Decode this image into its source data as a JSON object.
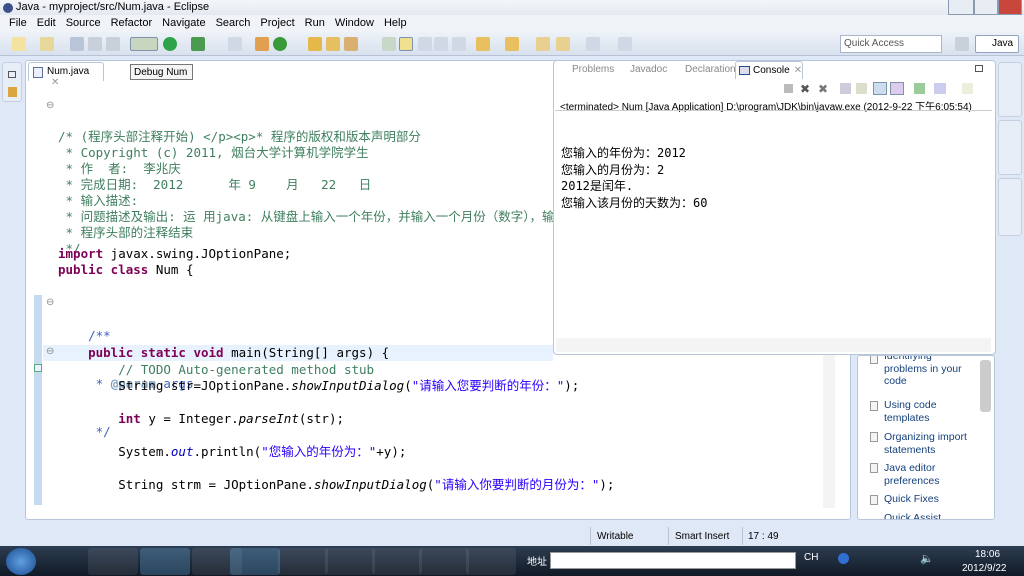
{
  "window": {
    "title": "Java - myproject/src/Num.java - Eclipse"
  },
  "menu": [
    "File",
    "Edit",
    "Source",
    "Refactor",
    "Navigate",
    "Search",
    "Project",
    "Run",
    "Window",
    "Help"
  ],
  "toolbar": {
    "quick_access_placeholder": "Quick Access",
    "perspective": "Java"
  },
  "editor": {
    "tab": "Num.java",
    "tooltip": "Debug Num",
    "comment": [
      "/* (程序头部注释开始) </p><p>* 程序的版权和版本声明部分",
      " * Copyright (c) 2011, 烟台大学计算机学院学生",
      " * 作  者:  李兆庆",
      " * 完成日期:  2012      年 9    月   22   日",
      " * 输入描述:",
      " * 问题描述及输出: 运 用java: 从键盘上输入一个年份，并输入一个月份（数字），输出该月份?",
      " * 程序头部的注释结束",
      " */"
    ],
    "import_kw": "import",
    "import_rest": " javax.swing.JOptionPane;",
    "class_kw": "public class",
    "class_rest": " Num {",
    "jd1": "    /**",
    "jd2_pre": "     * ",
    "jd2_tag": "@param",
    "jd2_rest": " args",
    "jd3": "     */",
    "main_kw": "    public static void",
    "main_rest": " main(String[] args) {",
    "todo": "        // TODO Auto-generated method stub",
    "l1_a": "        String str=JOptionPane.",
    "l1_m": "showInputDialog",
    "l1_b": "(",
    "l1_s": "\"请输入您要判断的年份：\"",
    "l1_c": ");",
    "l2_kw": "        int",
    "l2_a": " y = Integer.",
    "l2_m": "parseInt",
    "l2_b": "(str);",
    "l3_a": "        System.",
    "l3_f": "out",
    "l3_b": ".println(",
    "l3_s": "\"您输入的年份为：\"",
    "l3_c": "+y);",
    "l4_a": "        String strm = JOptionPane.",
    "l4_m": "showInputDialog",
    "l4_b": "(",
    "l4_s": "\"请输入你要判断的月份为：\"",
    "l4_c": ");"
  },
  "console": {
    "tabs": [
      "Problems",
      "Javadoc",
      "Declaration",
      "Console"
    ],
    "terminated": "<terminated> Num [Java Application] D:\\program\\JDK\\bin\\javaw.exe (2012-9-22 下午6:05:54)",
    "output": [
      "您输入的年份为：2012",
      "您输入的月份为：2",
      "2012是闰年.",
      "您输入该月份的天数为：60"
    ]
  },
  "help": {
    "items": [
      "Identifying problems in your code",
      "Using code templates",
      "Organizing import statements",
      "Java editor preferences",
      "Quick Fixes",
      "Quick Assist"
    ]
  },
  "status": {
    "writable": "Writable",
    "insert_mode": "Smart Insert",
    "position": "17 : 49"
  },
  "taskbar": {
    "address_label": "地址",
    "lang": "CH",
    "time": "18:06",
    "date": "2012/9/22"
  }
}
